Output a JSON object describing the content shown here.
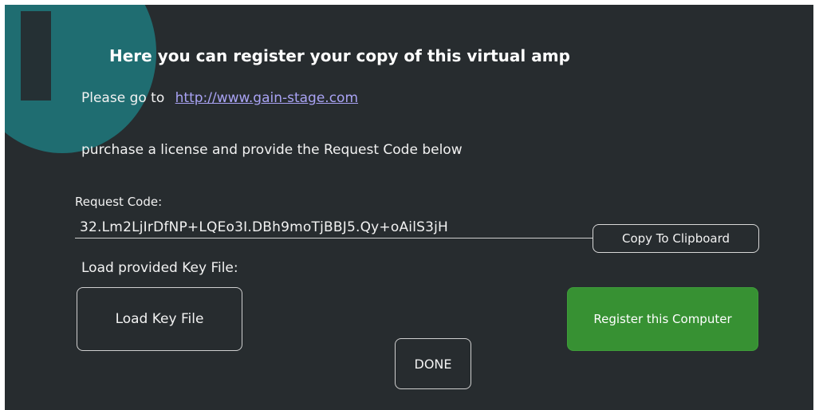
{
  "colors": {
    "background": "#272c2f",
    "info_badge": "#1f6d71",
    "link": "#a9a3f4",
    "register_button": "#379133",
    "text": "#f2f2f2"
  },
  "icons": {
    "info": "info-icon"
  },
  "title": "Here you can register your copy of this virtual amp",
  "goto": {
    "prefix": "Please go to",
    "link": "http://www.gain-stage.com"
  },
  "instructions": "purchase a license and provide the Request Code below",
  "request_code": {
    "label": "Request Code:",
    "value": "32.Lm2LjIrDfNP+LQEo3I.DBh9moTjBBJ5.Qy+oAilS3jH"
  },
  "buttons": {
    "copy": "Copy To Clipboard",
    "load_key": "Load Key File",
    "register": "Register this Computer",
    "done": "DONE"
  },
  "key_file_label": "Load provided Key File:"
}
